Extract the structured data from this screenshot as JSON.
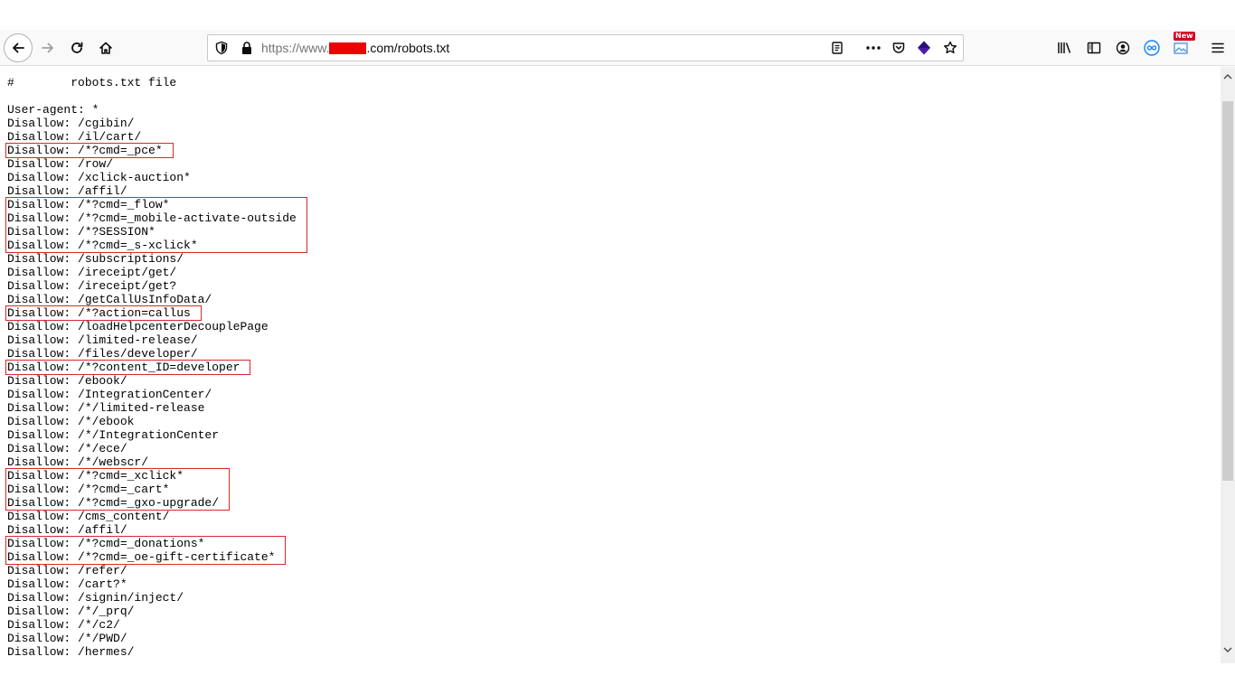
{
  "browser": {
    "url": {
      "prefix": "https://www.",
      "suffix": ".com/robots.txt"
    },
    "badges": {
      "new_label": "New"
    },
    "icons": {
      "back": "arrow-left-icon",
      "forward": "arrow-right-icon",
      "reload": "reload-icon",
      "home": "home-icon",
      "site_info": "shield-icon",
      "lock": "lock-icon",
      "reader": "reader-view-icon",
      "page_actions": "ellipsis-icon",
      "pocket": "pocket-icon",
      "extension": "extension-cube-icon",
      "bookmark": "star-icon",
      "library": "library-icon",
      "sidebar": "sidebar-icon",
      "account": "account-icon",
      "sync": "infinity-icon",
      "screenshot": "screenshot-icon",
      "menu": "hamburger-menu-icon"
    },
    "colors": {
      "redaction": "#ee0000",
      "highlight_box": "#d42a2a",
      "extension_icon": "#4b1ba8",
      "sync_icon": "#0a84ff"
    }
  },
  "document": {
    "lines": [
      "#        robots.txt file",
      "",
      "User-agent: *",
      "Disallow: /cgibin/",
      "Disallow: /il/cart/",
      "Disallow: /*?cmd=_pce*",
      "Disallow: /row/",
      "Disallow: /xclick-auction*",
      "Disallow: /affil/",
      "Disallow: /*?cmd=_flow*",
      "Disallow: /*?cmd=_mobile-activate-outside",
      "Disallow: /*?SESSION*",
      "Disallow: /*?cmd=_s-xclick*",
      "Disallow: /subscriptions/",
      "Disallow: /ireceipt/get/",
      "Disallow: /ireceipt/get?",
      "Disallow: /getCallUsInfoData/",
      "Disallow: /*?action=callus",
      "Disallow: /loadHelpcenterDecouplePage",
      "Disallow: /limited-release/",
      "Disallow: /files/developer/",
      "Disallow: /*?content_ID=developer",
      "Disallow: /ebook/",
      "Disallow: /IntegrationCenter/",
      "Disallow: /*/limited-release",
      "Disallow: /*/ebook",
      "Disallow: /*/IntegrationCenter",
      "Disallow: /*/ece/",
      "Disallow: /*/webscr/",
      "Disallow: /*?cmd=_xclick*",
      "Disallow: /*?cmd=_cart*",
      "Disallow: /*?cmd=_gxo-upgrade/",
      "Disallow: /cms_content/",
      "Disallow: /affil/",
      "Disallow: /*?cmd=_donations*",
      "Disallow: /*?cmd=_oe-gift-certificate*",
      "Disallow: /refer/",
      "Disallow: /cart?*",
      "Disallow: /signin/inject/",
      "Disallow: /*/_prq/",
      "Disallow: /*/c2/",
      "Disallow: /*/PWD/",
      "Disallow: /hermes/"
    ],
    "highlighted_groups": [
      [
        5,
        5
      ],
      [
        9,
        12
      ],
      [
        17,
        17
      ],
      [
        21,
        21
      ],
      [
        29,
        31
      ],
      [
        34,
        35
      ]
    ]
  }
}
